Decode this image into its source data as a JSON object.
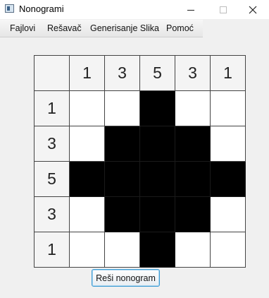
{
  "window": {
    "title": "Nonogrami",
    "app_icon": "window-app-icon",
    "controls": [
      "minimize-icon",
      "maximize-icon",
      "close-icon"
    ]
  },
  "menu": {
    "items": [
      "Fajlovi",
      "Rešavač",
      "Generisanje Slika",
      "Pomoć"
    ]
  },
  "puzzle": {
    "column_clues": [
      "1",
      "3",
      "5",
      "3",
      "1"
    ],
    "row_clues": [
      "1",
      "3",
      "5",
      "3",
      "1"
    ],
    "cells": [
      [
        0,
        0,
        1,
        0,
        0
      ],
      [
        0,
        1,
        1,
        1,
        0
      ],
      [
        1,
        1,
        1,
        1,
        1
      ],
      [
        0,
        1,
        1,
        1,
        0
      ],
      [
        0,
        0,
        1,
        0,
        0
      ]
    ],
    "filled_color": "#000000",
    "empty_color": "#ffffff"
  },
  "actions": {
    "solve_label": "Reši nonogram"
  }
}
